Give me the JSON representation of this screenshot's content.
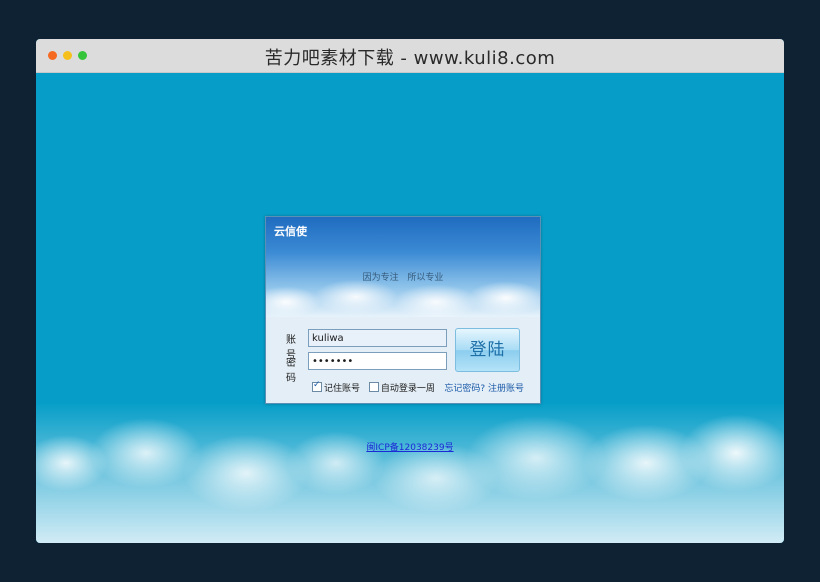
{
  "window": {
    "title": "苦力吧素材下载 - www.kuli8.com"
  },
  "login": {
    "brand": "云信使",
    "slogan": "因为专注  所以专业",
    "account_label": "账号",
    "account_value": "kuliwa",
    "password_label": "密码",
    "password_value": "kuliwa1",
    "login_button": "登陆",
    "remember_label": "记住账号",
    "remember_checked": true,
    "auto_login_label": "自动登录一周",
    "auto_login_checked": false,
    "forgot_password": "忘记密码?",
    "register": "注册账号"
  },
  "footer": {
    "icp": "闽ICP备12038239号"
  },
  "colors": {
    "background": "#069ec8",
    "outer": "#0f2234",
    "titlebar": "#dcdcdc",
    "link": "#1b5aa8"
  }
}
